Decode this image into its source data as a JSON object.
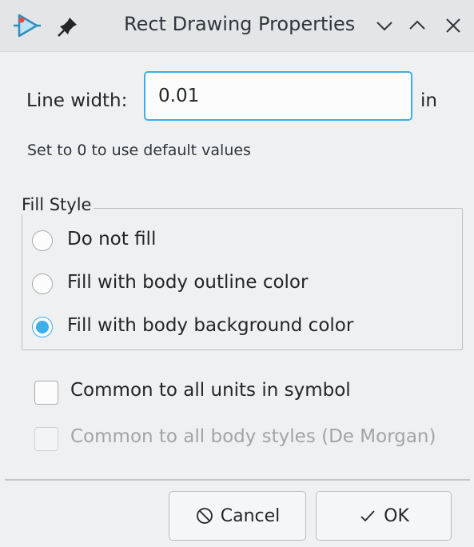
{
  "window": {
    "title": "Rect Drawing Properties",
    "icons": [
      "symbol-editor-icon",
      "pin-icon",
      "minimize-icon",
      "maximize-icon",
      "close-icon"
    ]
  },
  "line_width": {
    "label": "Line width:",
    "value": "0.01",
    "unit": "in",
    "hint": "Set to 0 to use default values"
  },
  "fill_style": {
    "title": "Fill Style",
    "options": [
      {
        "label": "Do not fill",
        "selected": false
      },
      {
        "label": "Fill with body outline color",
        "selected": false
      },
      {
        "label": "Fill with body background color",
        "selected": true
      }
    ]
  },
  "options": {
    "common_units": {
      "label": "Common to all units in symbol",
      "checked": false,
      "enabled": true
    },
    "common_styles": {
      "label": "Common to all body styles (De Morgan)",
      "checked": false,
      "enabled": false
    }
  },
  "buttons": {
    "cancel": "Cancel",
    "ok": "OK"
  },
  "colors": {
    "accent": "#3daee9",
    "background": "#eff0f1"
  }
}
